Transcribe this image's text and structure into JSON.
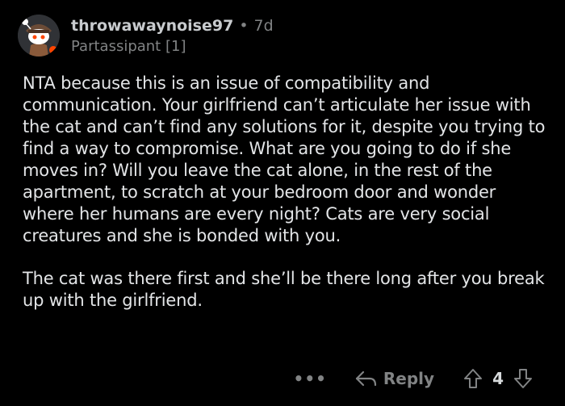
{
  "comment": {
    "username": "throwawaynoise97",
    "separator": "•",
    "age": "7d",
    "flair": "Partassipant [1]",
    "paragraphs": [
      "NTA because this is an issue of compatibility and communication. Your girlfriend can’t articulate her issue with the cat and can’t find any solutions for it, despite you trying to find a way to compromise. What are you going to do if she moves in? Will you leave the cat alone, in the rest of the apartment, to scratch at your bedroom door and wonder where her humans are every night? Cats are very social creatures and she is bonded with you.",
      "The cat was there first and she’ll be there long after you break up with the girlfriend."
    ],
    "actions": {
      "more": "•••",
      "reply": "Reply",
      "score": "4"
    }
  },
  "icons": {
    "avatar": "snoo-avatar",
    "reply": "reply-arrow-icon",
    "upvote": "upvote-arrow-icon",
    "downvote": "downvote-arrow-icon"
  },
  "colors": {
    "background": "#000000",
    "text": "#e3e5e7",
    "muted": "#818384"
  }
}
